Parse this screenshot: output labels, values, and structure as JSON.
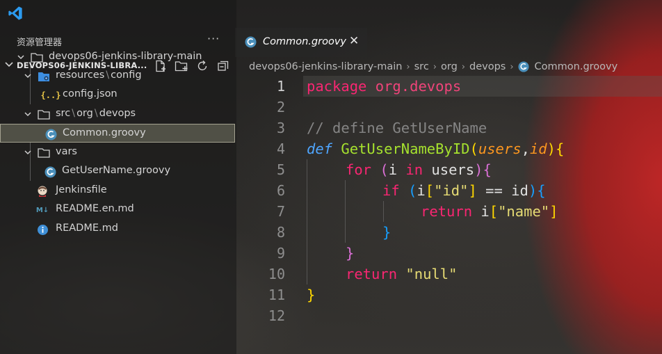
{
  "explorer": {
    "title": "资源管理器",
    "more": "···",
    "section_label": "DEVOPS06-JENKINS-LIBRA...",
    "actions": [
      "new-file-icon",
      "new-folder-icon",
      "refresh-icon",
      "collapse-all-icon"
    ]
  },
  "tree": {
    "root": "devops06-jenkins-library-main",
    "resources": "resources",
    "resources_sep": "\\",
    "resources_sub": "config",
    "config_json": "config.json",
    "src": "src",
    "src_sep1": "\\",
    "src_org": "org",
    "src_sep2": "\\",
    "src_devops": "devops",
    "common_groovy": "Common.groovy",
    "vars": "vars",
    "getusername": "GetUserName.groovy",
    "jenkinsfile": "Jenkinsfile",
    "readme_en": "README.en.md",
    "readme": "README.md"
  },
  "tab": {
    "name": "Common.groovy",
    "close": "✕"
  },
  "breadcrumb": {
    "items": [
      "devops06-jenkins-library-main",
      "src",
      "org",
      "devops",
      "Common.groovy"
    ],
    "separator": "›"
  },
  "editor": {
    "line_numbers": [
      "1",
      "2",
      "3",
      "4",
      "5",
      "6",
      "7",
      "8",
      "9",
      "10",
      "11",
      "12"
    ],
    "tokens": {
      "l1_kw": "package",
      "l1_pkg": "org.devops",
      "l3_comment": "// define GetUserName",
      "l4_def": "def",
      "l4_fn": "GetUserNameByID",
      "l4_open": "(",
      "l4_p1": "users",
      "l4_comma": ",",
      "l4_p2": "id",
      "l4_close": ")",
      "l4_brace": "{",
      "l5_for": "for",
      "l5_open": "(",
      "l5_i": "i ",
      "l5_in": "in",
      "l5_users": " users",
      "l5_close": ")",
      "l5_brace": "{",
      "l6_if": "if",
      "l6_open": "(",
      "l6_i": "i",
      "l6_lb": "[",
      "l6_str": "\"id\"",
      "l6_rb": "]",
      "l6_eq": " == id",
      "l6_close": ")",
      "l6_brace": "{",
      "l7_return": "return",
      "l7_i": " i",
      "l7_lb": "[",
      "l7_str": "\"name\"",
      "l7_rb": "]",
      "l8_brace": "}",
      "l9_brace": "}",
      "l10_return": "return",
      "l10_str": " \"null\"",
      "l11_brace": "}"
    }
  }
}
